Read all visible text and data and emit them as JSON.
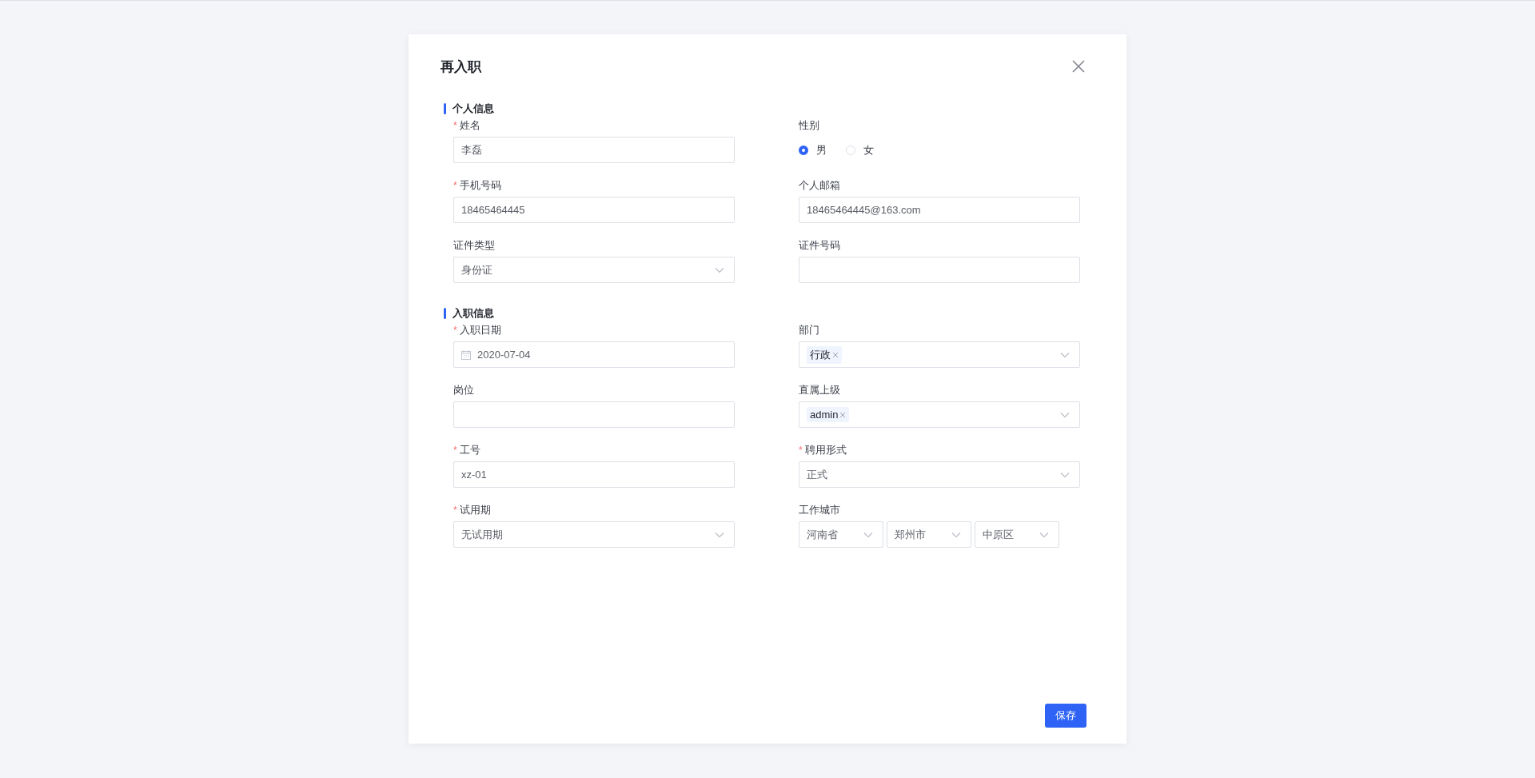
{
  "dialog": {
    "title": "再入职",
    "save_button": "保存"
  },
  "sections": [
    {
      "title": "个人信息",
      "fields": [
        {
          "kind": "text",
          "label": "姓名",
          "required_mark": "*",
          "value": "李磊"
        },
        {
          "kind": "radio",
          "label": "性别",
          "options": [
            {
              "label": "男",
              "selected": true
            },
            {
              "label": "女",
              "selected": false
            }
          ]
        },
        {
          "kind": "text",
          "label": "手机号码",
          "required_mark": "*",
          "value": "18465464445"
        },
        {
          "kind": "text",
          "label": "个人邮箱",
          "value": "18465464445@163.com"
        },
        {
          "kind": "select",
          "label": "证件类型",
          "value": "身份证"
        },
        {
          "kind": "text",
          "label": "证件号码"
        }
      ]
    },
    {
      "title": "入职信息",
      "fields": [
        {
          "kind": "date",
          "label": "入职日期",
          "required_mark": "*",
          "value": "2020-07-04"
        },
        {
          "kind": "tags",
          "label": "部门",
          "tags": [
            "行政"
          ]
        },
        {
          "kind": "text",
          "label": "岗位"
        },
        {
          "kind": "tags",
          "label": "直属上级",
          "tags": [
            "admin"
          ]
        },
        {
          "kind": "text",
          "label": "工号",
          "required_mark": "*",
          "value": "xz-01"
        },
        {
          "kind": "select",
          "label": "聘用形式",
          "required_mark": "*",
          "value": "正式"
        },
        {
          "kind": "select",
          "label": "试用期",
          "required_mark": "*",
          "value": "无试用期"
        },
        {
          "kind": "cascade",
          "label": "工作城市",
          "parts": [
            "河南省",
            "郑州市",
            "中原区"
          ]
        }
      ]
    }
  ]
}
